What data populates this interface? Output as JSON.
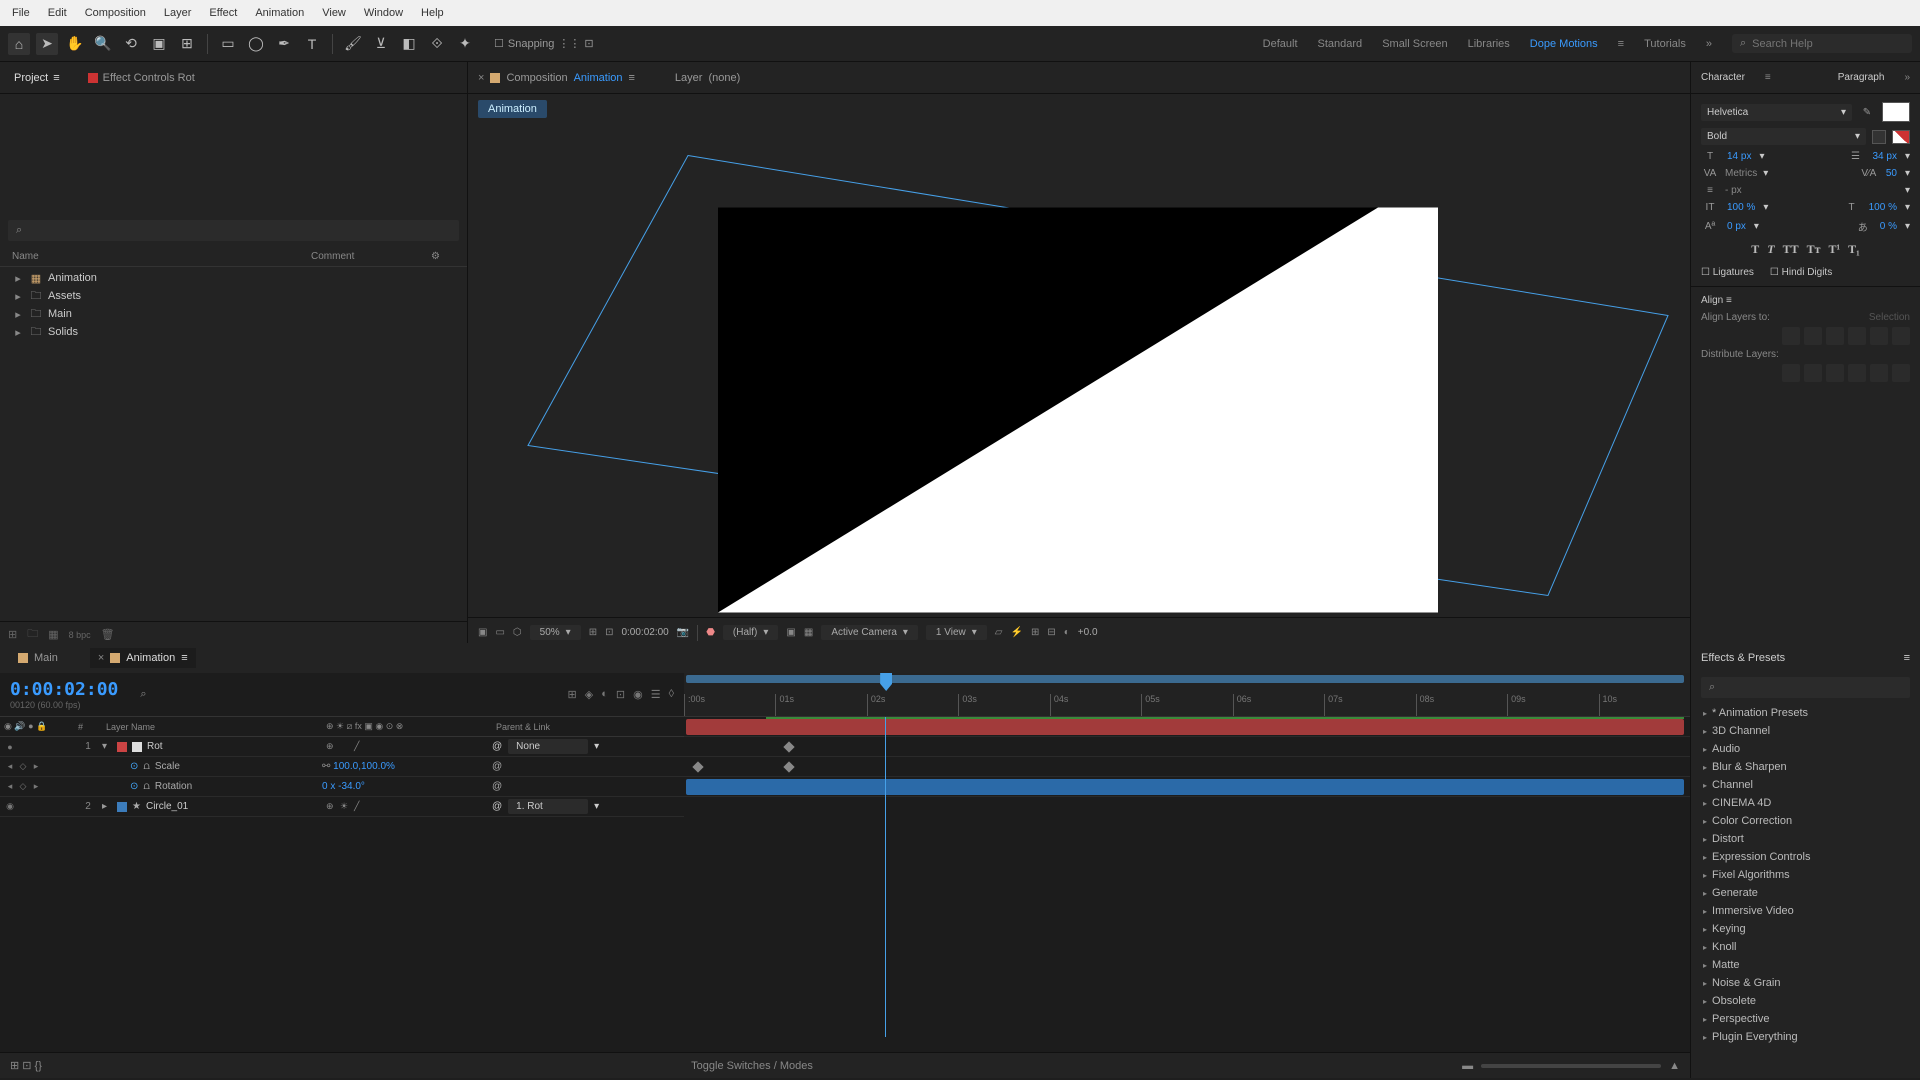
{
  "menubar": [
    "File",
    "Edit",
    "Composition",
    "Layer",
    "Effect",
    "Animation",
    "View",
    "Window",
    "Help"
  ],
  "toolbar": {
    "snapping_label": "Snapping"
  },
  "workspaces": {
    "items": [
      "Default",
      "Standard",
      "Small Screen",
      "Libraries",
      "Dope Motions",
      "Tutorials"
    ],
    "active": "Dope Motions",
    "search_placeholder": "Search Help"
  },
  "project": {
    "tab_project": "Project",
    "tab_fx": "Effect Controls Rot",
    "col_name": "Name",
    "col_comment": "Comment",
    "items": [
      {
        "name": "Animation",
        "type": "comp"
      },
      {
        "name": "Assets",
        "type": "folder"
      },
      {
        "name": "Main",
        "type": "folder"
      },
      {
        "name": "Solids",
        "type": "folder"
      }
    ]
  },
  "comp": {
    "tab_composition": "Composition",
    "tab_composition_name": "Animation",
    "tab_layer": "Layer",
    "tab_layer_none": "(none)",
    "breadcrumb": "Animation"
  },
  "viewer": {
    "zoom": "50%",
    "time": "0:00:02:00",
    "res": "(Half)",
    "camera": "Active Camera",
    "views": "1 View",
    "exposure": "+0.0"
  },
  "character": {
    "panel_char": "Character",
    "panel_para": "Paragraph",
    "font": "Helvetica",
    "style": "Bold",
    "size": "14 px",
    "leading": "34 px",
    "kerning": "Metrics",
    "tracking": "50",
    "indent": "- px",
    "vscale": "100 %",
    "hscale": "100 %",
    "baseline": "0 px",
    "tsume": "0 %",
    "ligatures": "Ligatures",
    "hindi": "Hindi Digits"
  },
  "align": {
    "title": "Align",
    "align_to": "Align Layers to:",
    "align_to_val": "Selection",
    "distribute": "Distribute Layers:"
  },
  "timeline": {
    "tabs": [
      "Main",
      "Animation"
    ],
    "timecode": "0:00:02:00",
    "frames_info": "00120 (60.00 fps)",
    "col_layer": "Layer Name",
    "col_parent": "Parent & Link",
    "toggle": "Toggle Switches / Modes",
    "ticks": [
      ":00s",
      "01s",
      "02s",
      "03s",
      "04s",
      "05s",
      "06s",
      "07s",
      "08s",
      "09s",
      "10s"
    ],
    "layers": [
      {
        "num": "1",
        "name": "Rot",
        "label": "red",
        "parent": "None",
        "open": true,
        "props": [
          {
            "name": "Scale",
            "val": "100.0,100.0%"
          },
          {
            "name": "Rotation",
            "val": "0 x -34.0°"
          }
        ]
      },
      {
        "num": "2",
        "name": "Circle_01",
        "label": "blue",
        "parent": "1. Rot",
        "open": false
      }
    ]
  },
  "effects": {
    "title": "Effects & Presets",
    "items": [
      "* Animation Presets",
      "3D Channel",
      "Audio",
      "Blur & Sharpen",
      "Channel",
      "CINEMA 4D",
      "Color Correction",
      "Distort",
      "Expression Controls",
      "Fixel Algorithms",
      "Generate",
      "Immersive Video",
      "Keying",
      "Knoll",
      "Matte",
      "Noise & Grain",
      "Obsolete",
      "Perspective",
      "Plugin Everything"
    ]
  }
}
